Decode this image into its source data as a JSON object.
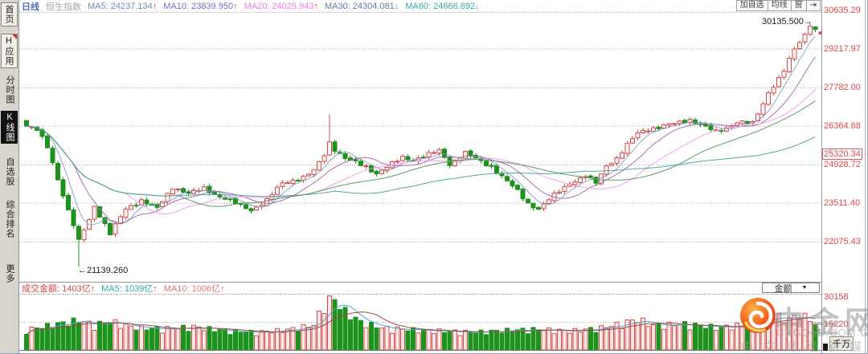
{
  "sidebar": {
    "items": [
      {
        "label": "首页",
        "style": "btn"
      },
      {
        "label": "H应用",
        "style": "btn",
        "badge": true
      },
      {
        "label": "分时图"
      },
      {
        "label": "K线图",
        "active": true
      },
      {
        "label": "自选股"
      },
      {
        "label": "综合排名"
      },
      {
        "label": "更多"
      }
    ]
  },
  "header": {
    "period": "日线",
    "symbol": "恒生指数",
    "ma_items": [
      {
        "label": "MA5:",
        "value": "24237.134",
        "dir": "up",
        "color": "#6E8FB5"
      },
      {
        "label": "MA10:",
        "value": "23839.950",
        "dir": "up",
        "color": "#7E66C8"
      },
      {
        "label": "MA20:",
        "value": "24025.943",
        "dir": "up",
        "color": "#EE7DE8"
      },
      {
        "label": "MA30:",
        "value": "24304.081",
        "dir": "down",
        "color": "#5B7FA6"
      },
      {
        "label": "MA60:",
        "value": "24666.692",
        "dir": "down",
        "color": "#3AA6A6"
      }
    ],
    "buttons": [
      "加自选",
      "均线",
      "窗"
    ],
    "collapse_icon": "⇥"
  },
  "volume_header": {
    "items": [
      {
        "label": "成交金额:",
        "value": "1403亿",
        "dir": "up",
        "color": "#D04A4A"
      },
      {
        "label": "MA5:",
        "value": "1039亿",
        "dir": "up",
        "color": "#2BA8A8"
      },
      {
        "label": "MA10:",
        "value": "1006亿",
        "dir": "up",
        "color": "#E07878"
      }
    ],
    "dropdown": "金额",
    "dropdown_caret": "▼"
  },
  "axis": {
    "price_labels": [
      "30635.29",
      "29217.97",
      "27782.00",
      "26364.68",
      "24928.72",
      "23511.40",
      "22075.43"
    ],
    "price_marker": "25320.34",
    "volume_labels": [
      "30158",
      "15220"
    ],
    "volume_unit": "千万",
    "label_color": "#E14747"
  },
  "annotations": {
    "high_label": "30135.500",
    "high_arrow": "→",
    "low_label": "21139.260",
    "low_arrow": "←"
  },
  "watermark": {
    "title": "中金网",
    "domain": "CNGOLD.COM.CN",
    "tagline": "中文财经新媒体"
  },
  "chart_data": {
    "type": "candlestick",
    "symbol": "恒生指数",
    "period": "日线",
    "candle_count": 152,
    "y_axis_values": [
      30635.29,
      29217.97,
      27782.0,
      26364.68,
      24928.72,
      23511.4,
      22075.43
    ],
    "price_marker_value": 25320.34,
    "annotated_high": 30135.5,
    "annotated_low": 21139.26,
    "ma_values": {
      "MA5": 24237.134,
      "MA10": 23839.95,
      "MA20": 24025.943,
      "MA30": 24304.081,
      "MA60": 24666.692
    },
    "volume": {
      "last_amount": "1403亿",
      "ma5": "1039亿",
      "ma10": "1006亿",
      "max": 30158,
      "mid": 15220,
      "unit": "千万"
    },
    "close_anchors": [
      [
        0,
        26350
      ],
      [
        2,
        26200
      ],
      [
        4,
        25600
      ],
      [
        6,
        24400
      ],
      [
        8,
        23200
      ],
      [
        10,
        22160
      ],
      [
        12,
        22900
      ],
      [
        13,
        23400
      ],
      [
        16,
        22350
      ],
      [
        19,
        23300
      ],
      [
        22,
        23600
      ],
      [
        25,
        23300
      ],
      [
        28,
        24100
      ],
      [
        31,
        23850
      ],
      [
        34,
        24050
      ],
      [
        37,
        23750
      ],
      [
        40,
        23500
      ],
      [
        43,
        23250
      ],
      [
        46,
        23600
      ],
      [
        49,
        24250
      ],
      [
        51,
        24350
      ],
      [
        53,
        24450
      ],
      [
        55,
        24700
      ],
      [
        57,
        25300
      ],
      [
        58,
        25750
      ],
      [
        59,
        25500
      ],
      [
        61,
        25150
      ],
      [
        63,
        25000
      ],
      [
        65,
        24850
      ],
      [
        67,
        24600
      ],
      [
        70,
        24950
      ],
      [
        72,
        25200
      ],
      [
        74,
        25100
      ],
      [
        77,
        25300
      ],
      [
        79,
        25450
      ],
      [
        81,
        24950
      ],
      [
        84,
        25350
      ],
      [
        87,
        25050
      ],
      [
        89,
        24850
      ],
      [
        92,
        24300
      ],
      [
        94,
        23950
      ],
      [
        96,
        23500
      ],
      [
        98,
        23280
      ],
      [
        101,
        23800
      ],
      [
        104,
        24250
      ],
      [
        106,
        24400
      ],
      [
        107,
        24500
      ],
      [
        109,
        24250
      ],
      [
        111,
        24900
      ],
      [
        113,
        25150
      ],
      [
        115,
        25650
      ],
      [
        117,
        26100
      ],
      [
        119,
        26250
      ],
      [
        121,
        26300
      ],
      [
        124,
        26450
      ],
      [
        127,
        26600
      ],
      [
        130,
        26300
      ],
      [
        132,
        26150
      ],
      [
        134,
        26300
      ],
      [
        136,
        26500
      ],
      [
        139,
        26450
      ],
      [
        141,
        27200
      ],
      [
        142,
        27600
      ],
      [
        144,
        28100
      ],
      [
        145,
        28400
      ],
      [
        147,
        29200
      ],
      [
        149,
        29750
      ],
      [
        150,
        30050
      ],
      [
        151,
        29930
      ]
    ],
    "volume_anchors": [
      [
        0,
        10500
      ],
      [
        4,
        12500
      ],
      [
        8,
        14500
      ],
      [
        10,
        15500
      ],
      [
        13,
        13000
      ],
      [
        16,
        15000
      ],
      [
        20,
        12000
      ],
      [
        26,
        11000
      ],
      [
        32,
        12000
      ],
      [
        38,
        10000
      ],
      [
        44,
        9200
      ],
      [
        50,
        10500
      ],
      [
        55,
        13000
      ],
      [
        57,
        24000
      ],
      [
        58,
        29500
      ],
      [
        59,
        26000
      ],
      [
        61,
        20000
      ],
      [
        64,
        14500
      ],
      [
        68,
        11500
      ],
      [
        74,
        10500
      ],
      [
        80,
        9800
      ],
      [
        86,
        9200
      ],
      [
        92,
        10200
      ],
      [
        98,
        10800
      ],
      [
        104,
        9800
      ],
      [
        110,
        11500
      ],
      [
        114,
        13800
      ],
      [
        117,
        16000
      ],
      [
        120,
        12800
      ],
      [
        126,
        13500
      ],
      [
        132,
        11800
      ],
      [
        137,
        12800
      ],
      [
        140,
        15500
      ],
      [
        143,
        17500
      ],
      [
        146,
        16000
      ],
      [
        148,
        18500
      ],
      [
        150,
        16000
      ],
      [
        151,
        14030
      ]
    ],
    "key_points": {
      "low_index": 10,
      "low_value": 21139.26,
      "spike_index": 58,
      "spike_high": 26782,
      "high_index": 150,
      "high_value": 30135.5,
      "last_close": 29930
    },
    "ma_windows": [
      5,
      10,
      20,
      30,
      60
    ],
    "ma_colors": [
      "#7C9DC0",
      "#9F5FA8",
      "#F394EC",
      "#4E9153",
      "#3D9D9D"
    ],
    "vol_ma_windows": [
      5,
      10
    ],
    "vol_ma_colors": [
      "#4AA8C8",
      "#A04848"
    ],
    "up_color": "#D14B4B",
    "up_fill": "#FFF7F7",
    "vol_up_fill": "#FBE9E9",
    "down_color": "#1D921D",
    "grid_color": "#A8A8A8"
  }
}
